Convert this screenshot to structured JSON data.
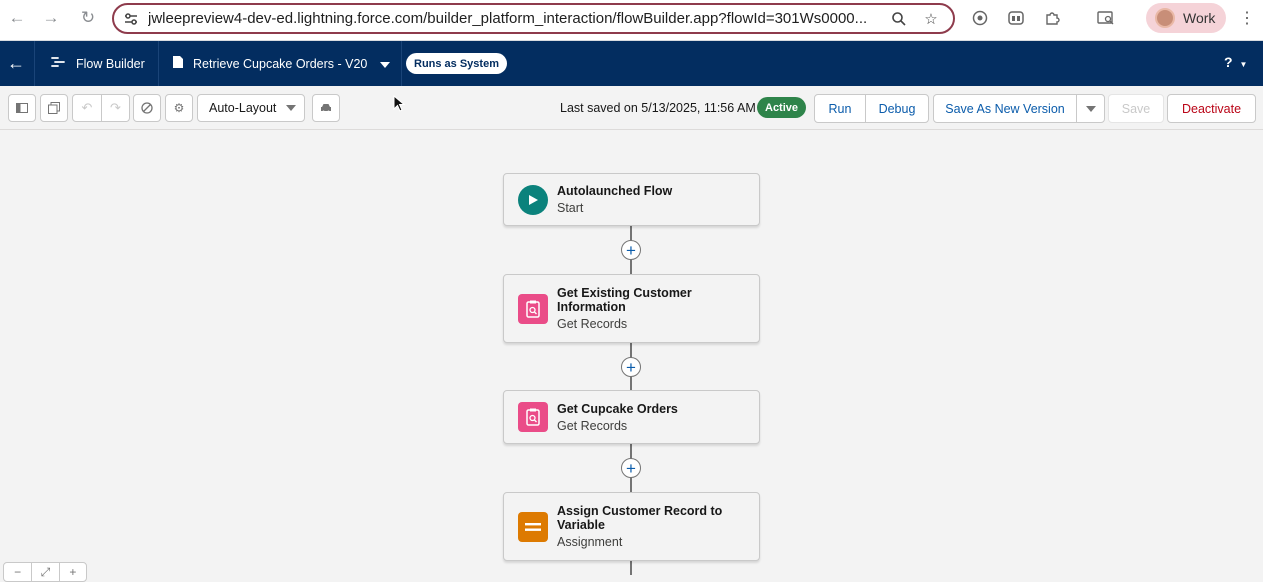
{
  "browser": {
    "url": "jwleepreview4-dev-ed.lightning.force.com/builder_platform_interaction/flowBuilder.app?flowId=301Ws0000...",
    "profile_name": "Work",
    "icons": [
      "back-arrow-icon",
      "forward-arrow-icon",
      "reload-icon",
      "site-settings-icon",
      "zoom-icon",
      "bookmark-star-icon",
      "extension-icon",
      "puzzle-icon",
      "tab-search-icon",
      "more-vert-icon"
    ]
  },
  "header": {
    "app_name": "Flow Builder",
    "flow_title": "Retrieve Cupcake Orders - V20",
    "runs_badge": "Runs as System",
    "help_label": "?"
  },
  "toolbar": {
    "layout_mode": "Auto-Layout",
    "last_saved": "Last saved on 5/13/2025, 11:56 AM",
    "status_badge": "Active",
    "run_label": "Run",
    "debug_label": "Debug",
    "save_as_new_version_label": "Save As New Version",
    "save_label": "Save",
    "deactivate_label": "Deactivate"
  },
  "canvas": {
    "nodes": [
      {
        "label": "Autolaunched Flow",
        "sublabel": "Start",
        "icon": "play-icon"
      },
      {
        "label": "Get Existing Customer Information",
        "sublabel": "Get Records",
        "icon": "get-records-icon"
      },
      {
        "label": "Get Cupcake Orders",
        "sublabel": "Get Records",
        "icon": "get-records-icon"
      },
      {
        "label": "Assign Customer Record to Variable",
        "sublabel": "Assignment",
        "icon": "assignment-icon"
      }
    ]
  },
  "colors": {
    "header_bg": "#032d60",
    "active_green": "#2e844a",
    "start_teal": "#0b827c",
    "get_records_pink": "#ea4c88",
    "assignment_orange": "#dd7a01",
    "brand_blue": "#0b5cab",
    "deactivate_red": "#ba0517"
  }
}
